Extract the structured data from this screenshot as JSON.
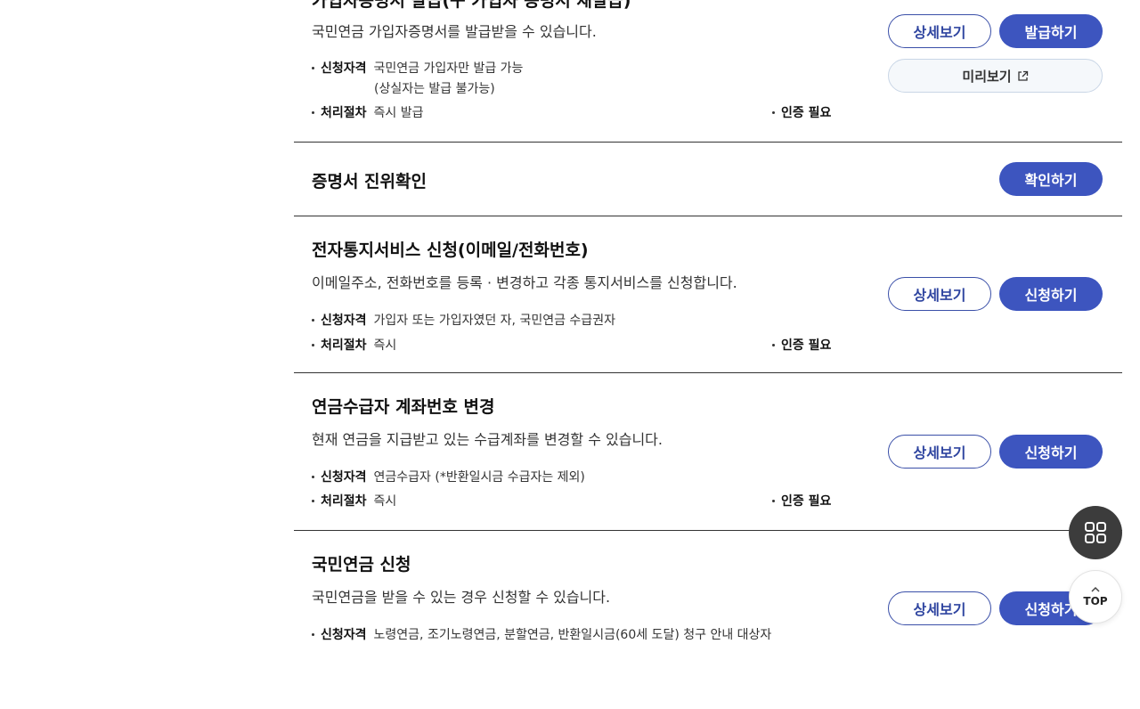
{
  "services": [
    {
      "title": "가입자증명서 발급(구 가입자 증명서 재발급)",
      "description": "국민연금 가입자증명서를 발급받을 수 있습니다.",
      "eligibility_label": "신청자격",
      "eligibility": "국민연금 가입자만 발급 가능",
      "eligibility_sub": "(상실자는 발급 불가능)",
      "procedure_label": "처리절차",
      "procedure": "즉시 발급",
      "auth": "인증 필요",
      "detail_button": "상세보기",
      "action_button": "발급하기",
      "preview_button": "미리보기"
    },
    {
      "title": "증명서 진위확인",
      "action_button": "확인하기"
    },
    {
      "title": "전자통지서비스 신청(이메일/전화번호)",
      "description": "이메일주소, 전화번호를 등록 · 변경하고 각종 통지서비스를 신청합니다.",
      "eligibility_label": "신청자격",
      "eligibility": "가입자 또는 가입자였던 자, 국민연금 수급권자",
      "procedure_label": "처리절차",
      "procedure": "즉시",
      "auth": "인증 필요",
      "detail_button": "상세보기",
      "action_button": "신청하기"
    },
    {
      "title": "연금수급자 계좌번호 변경",
      "description": "현재 연금을 지급받고 있는 수급계좌를 변경할 수 있습니다.",
      "eligibility_label": "신청자격",
      "eligibility": "연금수급자 (*반환일시금 수급자는 제외)",
      "procedure_label": "처리절차",
      "procedure": "즉시",
      "auth": "인증 필요",
      "detail_button": "상세보기",
      "action_button": "신청하기"
    },
    {
      "title": "국민연금 신청",
      "description": "국민연금을 받을 수 있는 경우 신청할 수 있습니다.",
      "eligibility_label": "신청자격",
      "eligibility": "노령연금, 조기노령연금, 분할연금, 반환일시금(60세 도달) 청구 안내 대상자",
      "detail_button": "상세보기",
      "action_button": "신청하기"
    }
  ],
  "floating": {
    "menu_icon": "grid-icon",
    "top_label": "TOP"
  },
  "colors": {
    "primary": "#3d55bf",
    "outline_text": "#2f45a0",
    "fab_dark": "#3c3c3c"
  }
}
